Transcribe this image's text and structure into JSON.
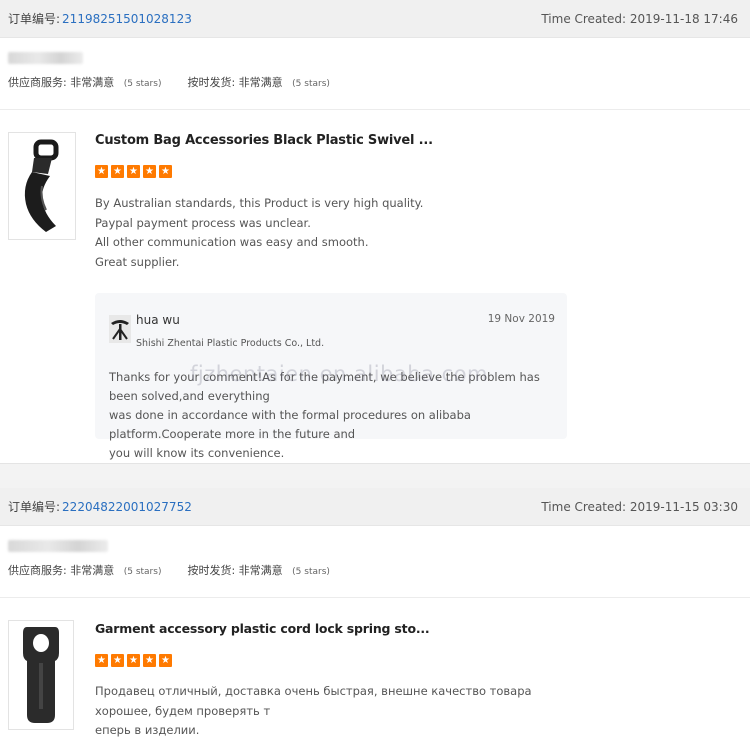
{
  "orders": [
    {
      "order_no_label": "订单编号:",
      "order_no": "21198251501028123",
      "time_created": "Time Created: 2019-11-18 17:46",
      "supplier_service_label": "供应商服务:",
      "supplier_service_value": "非常满意",
      "supplier_service_stars": "(5 stars)",
      "on_time_label": "按时发货:",
      "on_time_value": "非常满意",
      "on_time_stars": "(5 stars)",
      "product_title": "Custom Bag Accessories Black Plastic Swivel ...",
      "rating": 5,
      "review_lines": [
        "By Australian standards, this Product is very high quality.",
        "Paypal payment process was unclear.",
        "All other communication was easy and smooth.",
        "Great supplier."
      ],
      "reply": {
        "name": "hua wu",
        "company": "Shishi Zhentai Plastic Products Co., Ltd.",
        "date": "19 Nov 2019",
        "text_lines": [
          "Thanks for your comment!As for the payment, we believe the problem has been solved,and everything",
          "was done in accordance with the formal procedures on alibaba platform.Cooperate more in the future and",
          "you will know its convenience."
        ]
      }
    },
    {
      "order_no_label": "订单编号:",
      "order_no": "22204822001027752",
      "time_created": "Time Created: 2019-11-15 03:30",
      "supplier_service_label": "供应商服务:",
      "supplier_service_value": "非常满意",
      "supplier_service_stars": "(5 stars)",
      "on_time_label": "按时发货:",
      "on_time_value": "非常满意",
      "on_time_stars": "(5 stars)",
      "product_title": "Garment accessory plastic cord lock spring sto...",
      "rating": 5,
      "review_lines": [
        "Продавец отличный, доставка  очень быстрая, внешне качество товара хорошее, будем проверять т",
        "еперь в изделии."
      ]
    }
  ],
  "watermark": "fjzhentaien.en.alibaba.com",
  "colors": {
    "star": "#ff7a00",
    "order_link": "#2a6fc0",
    "header_bg": "#f0f0f0",
    "reply_bg": "#f6f7f9"
  },
  "icons": {
    "star": "star-icon",
    "avatar": "supplier-avatar-icon"
  }
}
